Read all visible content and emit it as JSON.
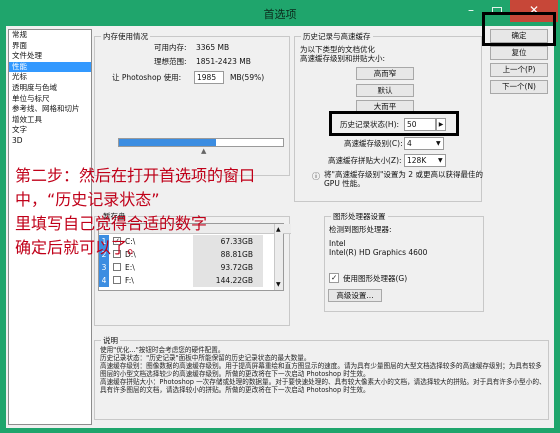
{
  "window": {
    "title": "首选项"
  },
  "nav": {
    "items": [
      "常规",
      "界面",
      "文件处理",
      "性能",
      "光标",
      "透明度与色域",
      "单位与标尺",
      "参考线、网格和切片",
      "增效工具",
      "文字",
      "3D"
    ],
    "selected_index": 3
  },
  "memory": {
    "legend": "内存使用情况",
    "available_label": "可用内存:",
    "available_value": "3365 MB",
    "ideal_label": "理想范围:",
    "ideal_value": "1851-2423 MB",
    "let_label": "让 Photoshop 使用:",
    "let_value": "1985",
    "let_unit": "MB(59%)",
    "slider_percent": 59
  },
  "history": {
    "legend": "历史记录与高速缓存",
    "optimize_line1": "为以下类型的文档优化",
    "optimize_line2": "高速缓存级别和拼贴大小:",
    "presets": [
      "高而窄",
      "默认",
      "大而平"
    ],
    "history_states_label": "历史记录状态(H):",
    "history_states_value": "50",
    "cache_levels_label": "高速缓存级别(C):",
    "cache_levels_value": "4",
    "cache_tile_label": "高速缓存拼贴大小(Z):",
    "cache_tile_value": "128K",
    "note_line1": "将\"高速缓存级别\"设置为 2 或更高以获得最佳的",
    "note_line2": "GPU 性能。"
  },
  "buttons": {
    "ok": "确定",
    "reset": "复位",
    "prev": "上一个(P)",
    "next": "下一个(N)"
  },
  "overlay": {
    "line1": "第二步：然后在打开首选项的窗口",
    "line2": "中，“历史记录状态”",
    "line3": "里填写自己觉得合适的数字",
    "line4": "确定后就可以了。"
  },
  "scratch": {
    "legend": "暂存盘",
    "rows": [
      {
        "num": "1",
        "checked": true,
        "drive": "C:\\",
        "free": "67.33GB"
      },
      {
        "num": "2",
        "checked": false,
        "drive": "D:\\",
        "free": "88.81GB"
      },
      {
        "num": "3",
        "checked": false,
        "drive": "E:\\",
        "free": "93.72GB"
      },
      {
        "num": "4",
        "checked": false,
        "drive": "F:\\",
        "free": "144.22GB"
      }
    ]
  },
  "gpu": {
    "legend": "图形处理器设置",
    "detected_label": "检测到图形处理器:",
    "vendor": "Intel",
    "model": "Intel(R) HD Graphics 4600",
    "use_gpu_label": "使用图形处理器(G)",
    "use_gpu_checked": true,
    "advanced_button": "高级设置..."
  },
  "description": {
    "legend": "说明",
    "text": "使用\"优化...\"按钮时会考虑您的硬件配置。\n历史记录状态：\"历史记录\"面板中所能保留的历史记录状态的最大数量。\n高速缓存级别：图像数据的高速缓存级别。用于提高屏幕重绘和直方图显示的速度。请为具有少量图层的大型文档选择较多的高速缓存级别；为具有较多图层的小型文档选择较少的高速缓存级别。所做的更改将在下一次启动 Photoshop 时生效。\n高速缓存拼贴大小：Photoshop 一次存储或处理的数据量。对于要快速处理的、具有较大像素大小的文档，请选择较大的拼贴。对于具有许多小型小的、具有许多图层的文档，请选择较小的拼贴。所做的更改将在下一次启动 Photoshop 时生效。"
  },
  "colors": {
    "titlebar": "#1fa56c",
    "close": "#c74738",
    "selection": "#3399ff",
    "overlay_text": "#c00019"
  }
}
